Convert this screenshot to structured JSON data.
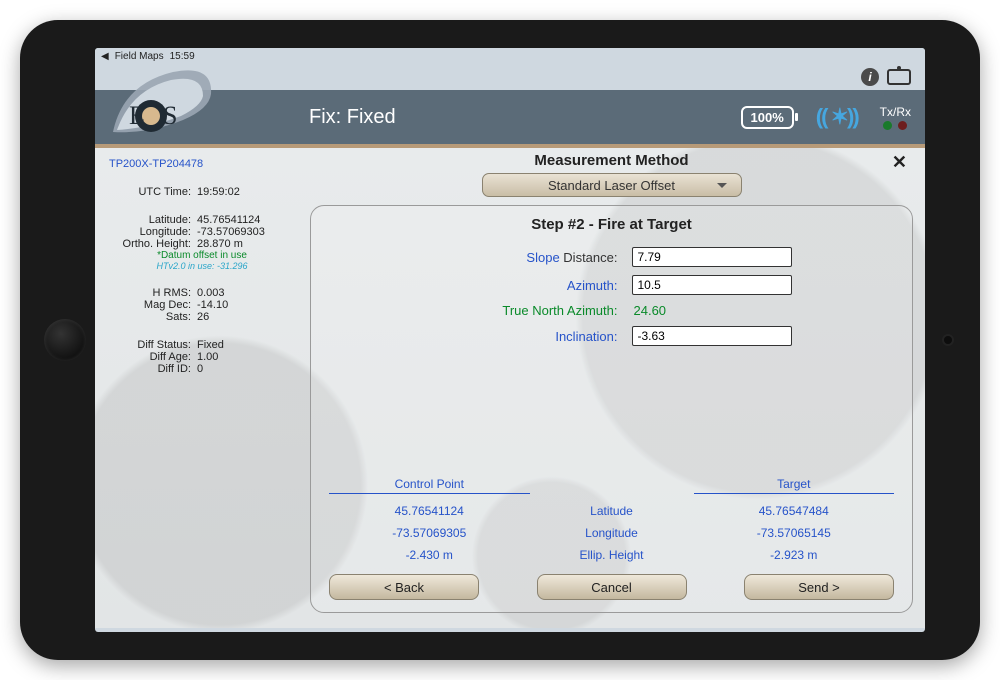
{
  "status_bar": {
    "back_app": "Field Maps",
    "time": "15:59"
  },
  "header": {
    "fix": "Fix: Fixed",
    "battery": "100%",
    "txrx": "Tx/Rx"
  },
  "device_id": "TP200X-TP204478",
  "sidebar": {
    "utc_label": "UTC Time:",
    "utc_value": "19:59:02",
    "lat_label": "Latitude:",
    "lat_value": "45.76541124",
    "lon_label": "Longitude:",
    "lon_value": "-73.57069303",
    "oh_label": "Ortho. Height:",
    "oh_value": "28.870 m",
    "datum": "*Datum offset in use",
    "htv": "HTv2.0 in use: -31.296",
    "hrms_label": "H RMS:",
    "hrms_value": "0.003",
    "mag_label": "Mag Dec:",
    "mag_value": "-14.10",
    "sats_label": "Sats:",
    "sats_value": "26",
    "dstat_label": "Diff Status:",
    "dstat_value": "Fixed",
    "dage_label": "Diff Age:",
    "dage_value": "1.00",
    "did_label": "Diff ID:",
    "did_value": "0"
  },
  "measurement": {
    "heading": "Measurement Method",
    "dropdown": "Standard Laser Offset",
    "step_title": "Step #2 - Fire at Target",
    "slope_label_a": "Slope ",
    "slope_label_b": "Distance:",
    "slope_value": "7.79",
    "az_label": "Azimuth:",
    "az_value": "10.5",
    "tna_label": "True North Azimuth:",
    "tna_value": "24.60",
    "inc_label": "Inclination:",
    "inc_value": "-3.63"
  },
  "coords": {
    "cp_header": "Control Point",
    "tgt_header": "Target",
    "lat_label": "Latitude",
    "lon_label": "Longitude",
    "eh_label": "Ellip. Height",
    "cp_lat": "45.76541124",
    "cp_lon": "-73.57069305",
    "cp_eh": "-2.430 m",
    "t_lat": "45.76547484",
    "t_lon": "-73.57065145",
    "t_eh": "-2.923 m"
  },
  "buttons": {
    "back": "< Back",
    "cancel": "Cancel",
    "send": "Send >"
  }
}
